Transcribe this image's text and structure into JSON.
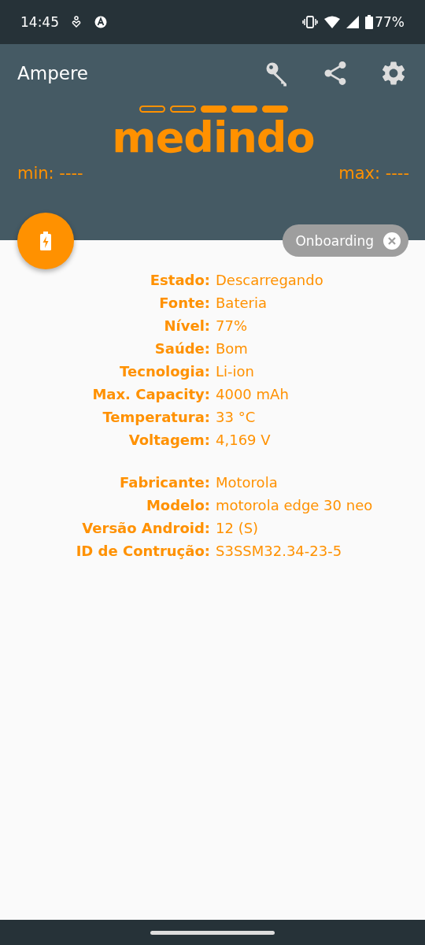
{
  "status_bar": {
    "time": "14:45",
    "battery": "77%"
  },
  "app_bar": {
    "title": "Ampere"
  },
  "measure": {
    "segments": [
      {
        "filled": false
      },
      {
        "filled": false
      },
      {
        "filled": true
      },
      {
        "filled": true
      },
      {
        "filled": true
      }
    ],
    "status": "medindo",
    "min": "min: ----",
    "max": "max: ----"
  },
  "chip": {
    "label": "Onboarding"
  },
  "groups": [
    {
      "rows": [
        {
          "label": "Estado:",
          "value": "Descarregando"
        },
        {
          "label": "Fonte:",
          "value": "Bateria"
        },
        {
          "label": "Nível:",
          "value": "77%"
        },
        {
          "label": "Saúde:",
          "value": "Bom"
        },
        {
          "label": "Tecnologia:",
          "value": "Li-ion"
        },
        {
          "label": "Max. Capacity:",
          "value": "4000 mAh"
        },
        {
          "label": "Temperatura:",
          "value": "33 °C"
        },
        {
          "label": "Voltagem:",
          "value": "4,169 V"
        }
      ]
    },
    {
      "rows": [
        {
          "label": "Fabricante:",
          "value": "Motorola"
        },
        {
          "label": "Modelo:",
          "value": "motorola edge 30 neo"
        },
        {
          "label": "Versão Android:",
          "value": "12 (S)"
        },
        {
          "label": "ID de Contrução:",
          "value": "S3SSM32.34-23-5"
        }
      ]
    }
  ]
}
